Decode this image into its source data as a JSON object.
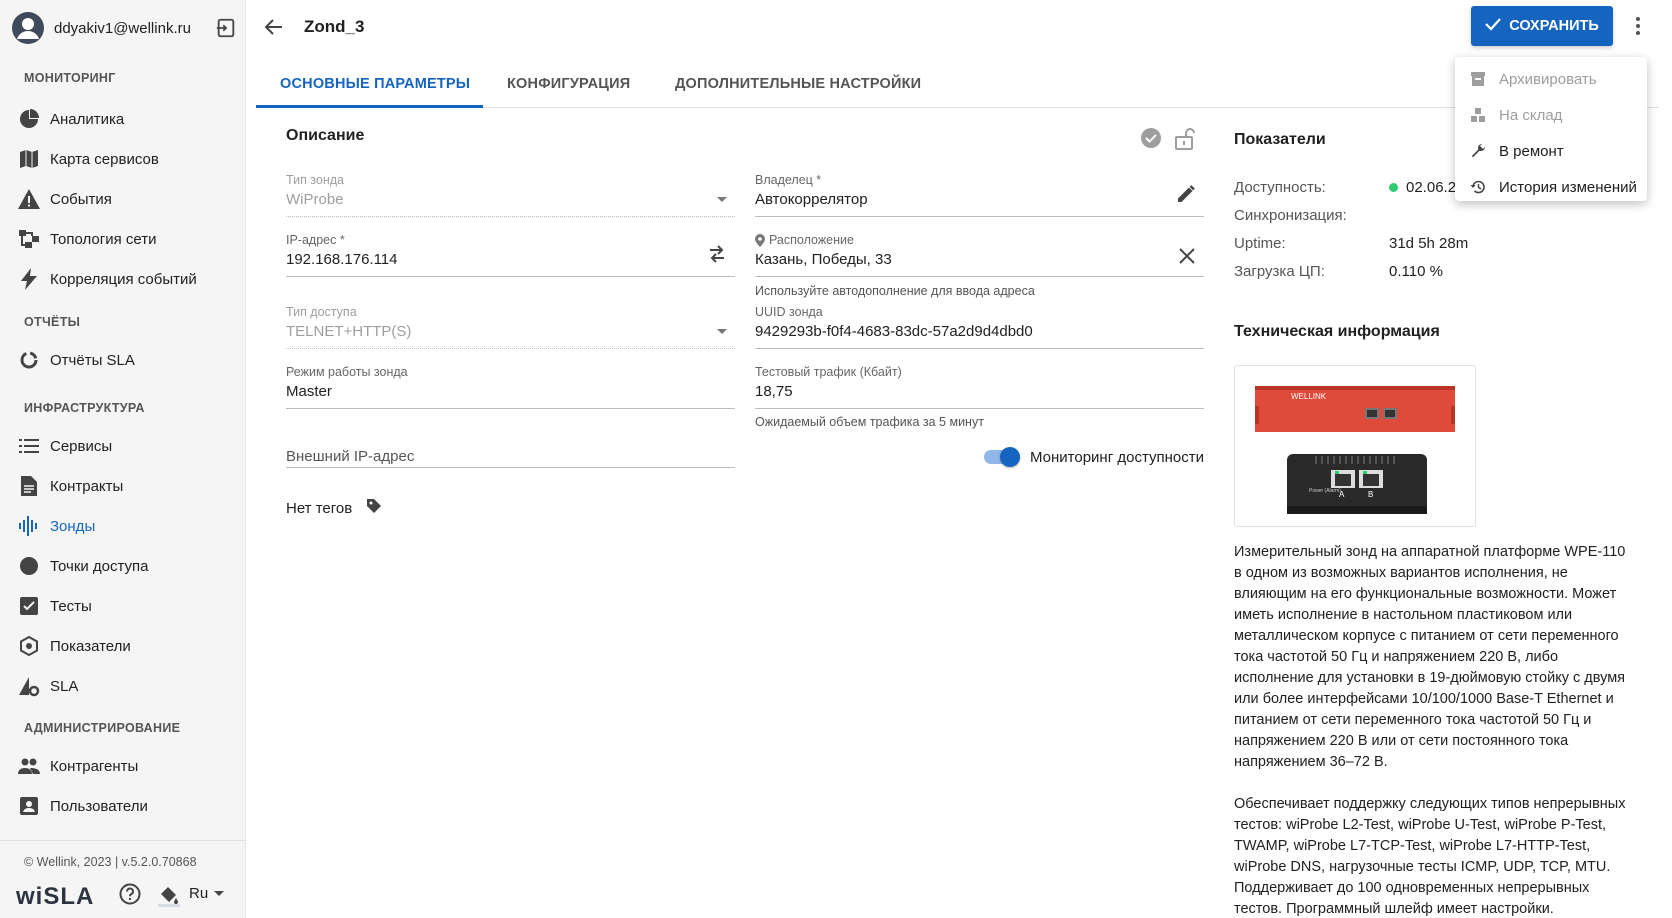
{
  "user": {
    "email": "ddyakiv1@wellink.ru"
  },
  "sidebar": {
    "sections": [
      {
        "title": "МОНИТОРИНГ"
      },
      {
        "title": "ОТЧЁТЫ"
      },
      {
        "title": "ИНФРАСТРУКТУРА"
      },
      {
        "title": "АДМИНИСТРИРОВАНИЕ"
      }
    ],
    "items": [
      {
        "label": "Аналитика",
        "icon": "pie-chart-icon"
      },
      {
        "label": "Карта сервисов",
        "icon": "map-icon"
      },
      {
        "label": "События",
        "icon": "warning-icon"
      },
      {
        "label": "Топология сети",
        "icon": "topology-icon"
      },
      {
        "label": "Корреляция событий",
        "icon": "bolt-icon"
      },
      {
        "label": "Отчёты SLA",
        "icon": "donut-chart-icon"
      },
      {
        "label": "Сервисы",
        "icon": "list-icon"
      },
      {
        "label": "Контракты",
        "icon": "document-icon"
      },
      {
        "label": "Зонды",
        "icon": "probe-icon",
        "active": true
      },
      {
        "label": "Точки доступа",
        "icon": "circle-icon"
      },
      {
        "label": "Тесты",
        "icon": "checkbox-icon"
      },
      {
        "label": "Показатели",
        "icon": "metrics-icon"
      },
      {
        "label": "SLA",
        "icon": "sla-gear-icon"
      },
      {
        "label": "Контрагенты",
        "icon": "people-icon"
      },
      {
        "label": "Пользователи",
        "icon": "user-card-icon"
      }
    ],
    "footer": {
      "copyright": "© Wellink, 2023 | v.5.2.0.70868",
      "brand": "wiSLA",
      "language": "Ru"
    }
  },
  "header": {
    "title": "Zond_3",
    "save_label": "СОХРАНИТЬ"
  },
  "tabs": [
    {
      "label": "ОСНОВНЫЕ ПАРАМЕТРЫ",
      "active": true
    },
    {
      "label": "КОНФИГУРАЦИЯ"
    },
    {
      "label": "ДОПОЛНИТЕЛЬНЫЕ НАСТРОЙКИ"
    }
  ],
  "form": {
    "title": "Описание",
    "probe_type": {
      "label": "Тип зонда",
      "value": "WiProbe"
    },
    "owner": {
      "label": "Владелец *",
      "value": "Автокоррелятор"
    },
    "ip": {
      "label": "IP-адрес *",
      "value": "192.168.176.114"
    },
    "location": {
      "label": "Расположение",
      "value": "Казань, Победы, 33",
      "helper": "Используйте автодополнение для ввода адреса"
    },
    "access_type": {
      "label": "Тип доступа",
      "value": "TELNET+HTTP(S)"
    },
    "uuid": {
      "label": "UUID зонда",
      "value": "9429293b-f0f4-4683-83dc-57a2d9d4dbd0"
    },
    "mode": {
      "label": "Режим работы зонда",
      "value": "Master"
    },
    "traffic": {
      "label": "Тестовый трафик (Кбайт)",
      "value": "18,75",
      "helper": "Ожидаемый объем трафика за 5 минут"
    },
    "external_ip": {
      "placeholder": "Внешний IP-адрес"
    },
    "monitoring_toggle": {
      "label": "Мониторинг доступности",
      "on": true
    },
    "tags": "Нет тегов"
  },
  "metrics": {
    "title": "Показатели",
    "availability": {
      "label": "Доступность:",
      "value": "02.06.2"
    },
    "sync": {
      "label": "Синхронизация:",
      "value": ""
    },
    "uptime": {
      "label": "Uptime:",
      "value": "31d 5h 28m"
    },
    "cpu": {
      "label": "Загрузка ЦП:",
      "value": "0.110 %"
    }
  },
  "tech": {
    "title": "Техническая информация",
    "device_image": {
      "brand": "WELLINK",
      "power_label": "Power (Alarm)",
      "port_a": "A",
      "port_b": "B"
    },
    "paragraphs": [
      "Измерительный зонд на аппаратной платформе WPE-110 в одном из возможных вариантов исполнения, не влияющим на его функциональные возможности. Может иметь исполнение в настольном пластиковом или металлическом корпусе с питанием от сети переменного тока частотой 50 Гц и напряжением 220 В, либо исполнение для установки в 19-дюймовую стойку с двумя или более интерфейсами 10/100/1000 Base-T Ethernet и питанием от сети переменного тока частотой 50 Гц и напряжением 220 В или от сети постоянного тока напряжением 36–72 В.",
      "Обеспечивает поддержку следующих типов непрерывных тестов: wiProbe L2-Test, wiProbe U-Test, wiProbe P-Test, TWAMP, wiProbe L7-TCP-Test, wiProbe L7-HTTP-Test, wiProbe DNS, нагрузочные тесты ICMP, UDP, TCP, MTU. Поддерживает до 100 одновременных непрерывных тестов. Программный шлейф имеет настройки."
    ]
  },
  "menu": {
    "items": [
      {
        "label": "Архивировать",
        "disabled": true
      },
      {
        "label": "На склад",
        "disabled": true
      },
      {
        "label": "В ремонт"
      },
      {
        "label": "История изменений"
      }
    ]
  },
  "colors": {
    "accent": "#1565c0",
    "status_ok": "#2ecc71",
    "device_red": "#e04a3a"
  }
}
